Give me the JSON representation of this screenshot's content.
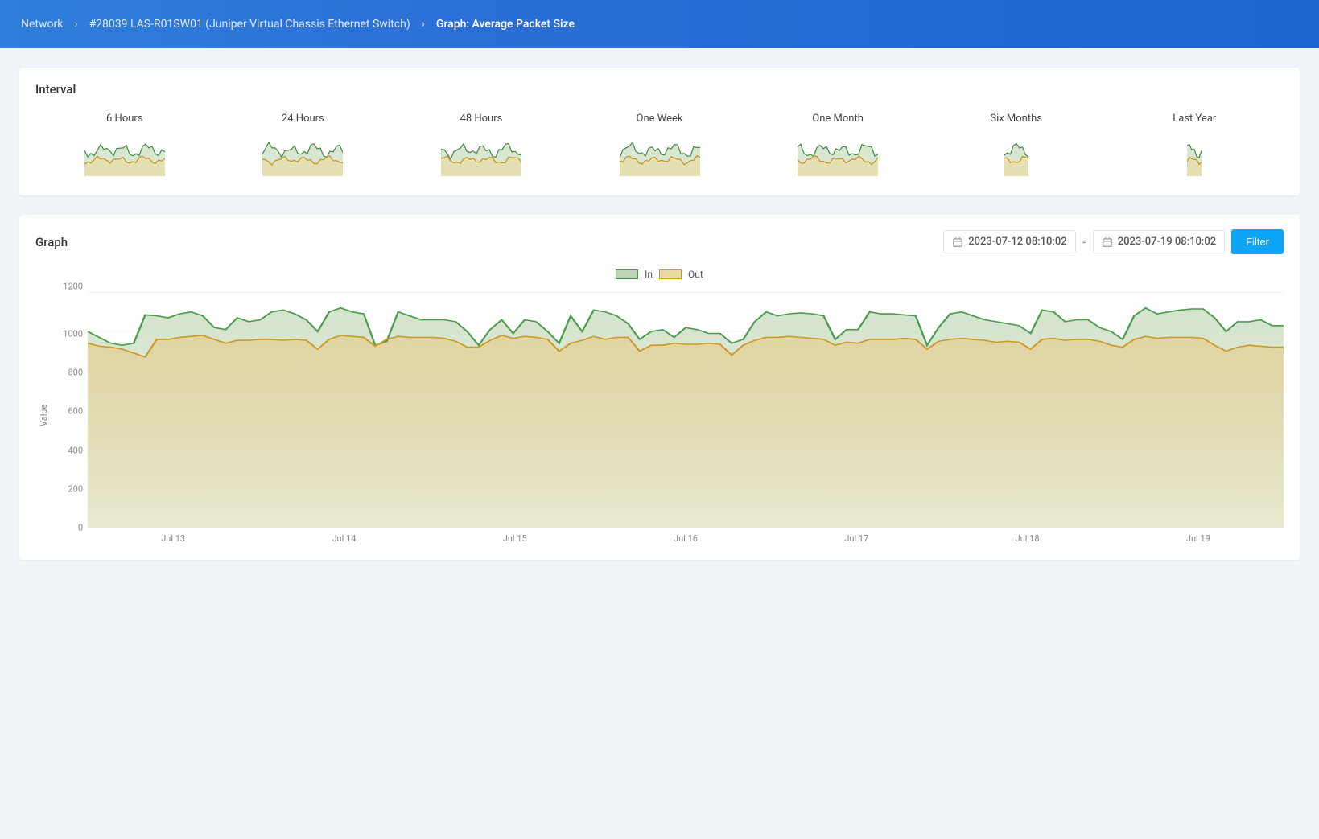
{
  "breadcrumb": {
    "root": "Network",
    "device": "#28039 LAS-R01SW01 (Juniper Virtual Chassis Ethernet Switch)",
    "current": "Graph: Average Packet Size"
  },
  "interval_panel": {
    "title": "Interval",
    "items": [
      {
        "label": "6 Hours"
      },
      {
        "label": "24 Hours"
      },
      {
        "label": "48 Hours"
      },
      {
        "label": "One Week"
      },
      {
        "label": "One Month"
      },
      {
        "label": "Six Months"
      },
      {
        "label": "Last Year"
      }
    ]
  },
  "graph_panel": {
    "title": "Graph",
    "date_from": "2023-07-12 08:10:02",
    "date_to": "2023-07-19 08:10:02",
    "range_separator": "-",
    "filter_label": "Filter",
    "legend": {
      "in": "In",
      "out": "Out"
    },
    "y_axis_label": "Value"
  },
  "chart_data": {
    "type": "area",
    "title": "",
    "xlabel": "",
    "ylabel": "Value",
    "ylim": [
      0,
      1230
    ],
    "y_ticks": [
      0,
      200,
      400,
      600,
      800,
      1000,
      1200
    ],
    "x_labels": [
      "Jul 13",
      "Jul 14",
      "Jul 15",
      "Jul 16",
      "Jul 17",
      "Jul 18",
      "Jul 19"
    ],
    "legend": [
      "In",
      "Out"
    ],
    "series": [
      {
        "name": "In",
        "color": "#4a9c4a",
        "fill": "#cfe0c7",
        "values": [
          1000,
          970,
          940,
          930,
          940,
          1085,
          1080,
          1070,
          1090,
          1100,
          1080,
          1020,
          1010,
          1070,
          1050,
          1060,
          1100,
          1110,
          1090,
          1060,
          1000,
          1100,
          1120,
          1100,
          1090,
          930,
          950,
          1100,
          1080,
          1060,
          1060,
          1060,
          1050,
          1000,
          930,
          1010,
          1060,
          990,
          1060,
          1050,
          1000,
          940,
          1080,
          1000,
          1110,
          1100,
          1080,
          1040,
          960,
          1000,
          1010,
          970,
          1020,
          1010,
          990,
          990,
          940,
          960,
          1050,
          1100,
          1080,
          1090,
          1095,
          1090,
          1080,
          960,
          1010,
          1010,
          1100,
          1090,
          1090,
          1085,
          1080,
          930,
          1020,
          1090,
          1100,
          1080,
          1060,
          1050,
          1040,
          1030,
          990,
          1110,
          1100,
          1050,
          1060,
          1060,
          1020,
          1000,
          960,
          1080,
          1120,
          1090,
          1100,
          1110,
          1115,
          1115,
          1070,
          1000,
          1050,
          1050,
          1060,
          1030,
          1030
        ]
      },
      {
        "name": "Out",
        "color": "#cc9b25",
        "fill": "#e2d39d",
        "values": [
          940,
          925,
          920,
          910,
          890,
          870,
          960,
          960,
          970,
          975,
          980,
          960,
          940,
          955,
          955,
          960,
          960,
          955,
          960,
          955,
          910,
          960,
          980,
          975,
          970,
          925,
          960,
          975,
          970,
          970,
          970,
          965,
          950,
          920,
          920,
          955,
          980,
          965,
          975,
          970,
          960,
          900,
          940,
          955,
          975,
          960,
          970,
          970,
          900,
          930,
          930,
          940,
          935,
          935,
          940,
          935,
          880,
          930,
          955,
          970,
          970,
          975,
          970,
          965,
          960,
          930,
          945,
          940,
          960,
          960,
          960,
          965,
          960,
          910,
          950,
          960,
          965,
          960,
          955,
          945,
          950,
          945,
          910,
          960,
          965,
          955,
          960,
          960,
          950,
          930,
          920,
          960,
          975,
          965,
          970,
          970,
          970,
          965,
          930,
          900,
          920,
          930,
          925,
          920,
          920
        ]
      }
    ]
  }
}
